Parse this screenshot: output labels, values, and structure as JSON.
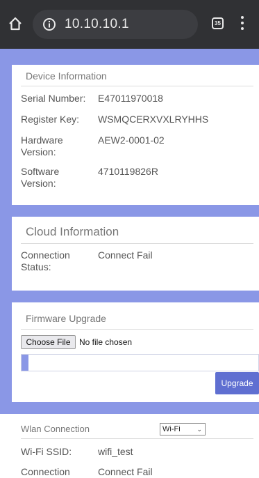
{
  "browser": {
    "url": "10.10.10.1",
    "tab_count": "35"
  },
  "device_info": {
    "title": "Device Information",
    "rows": [
      {
        "label": "Serial Number:",
        "value": "E47011970018"
      },
      {
        "label": "Register Key:",
        "value": "WSMQCERXVXLRYHHS"
      },
      {
        "label": "Hardware Version:",
        "value": "AEW2-0001-02"
      },
      {
        "label": "Software Version:",
        "value": "4710119826R"
      }
    ]
  },
  "cloud_info": {
    "title": "Cloud Information",
    "rows": [
      {
        "label": "Connection Status:",
        "value": "Connect Fail"
      }
    ]
  },
  "firmware": {
    "title": "Firmware Upgrade",
    "choose_file_label": "Choose File",
    "file_status": "No file chosen",
    "progress": 0.03,
    "upgrade_label": "Upgrade"
  },
  "wlan": {
    "title": "Wlan Connection",
    "mode_selected": "Wi-Fi",
    "rows": [
      {
        "label": "Wi-Fi SSID:",
        "value": "wifi_test"
      },
      {
        "label": "Connection",
        "value": "Connect Fail"
      }
    ]
  },
  "colors": {
    "toolbar": "#303134",
    "band": "#8a97e6",
    "button": "#5f6fd1"
  }
}
